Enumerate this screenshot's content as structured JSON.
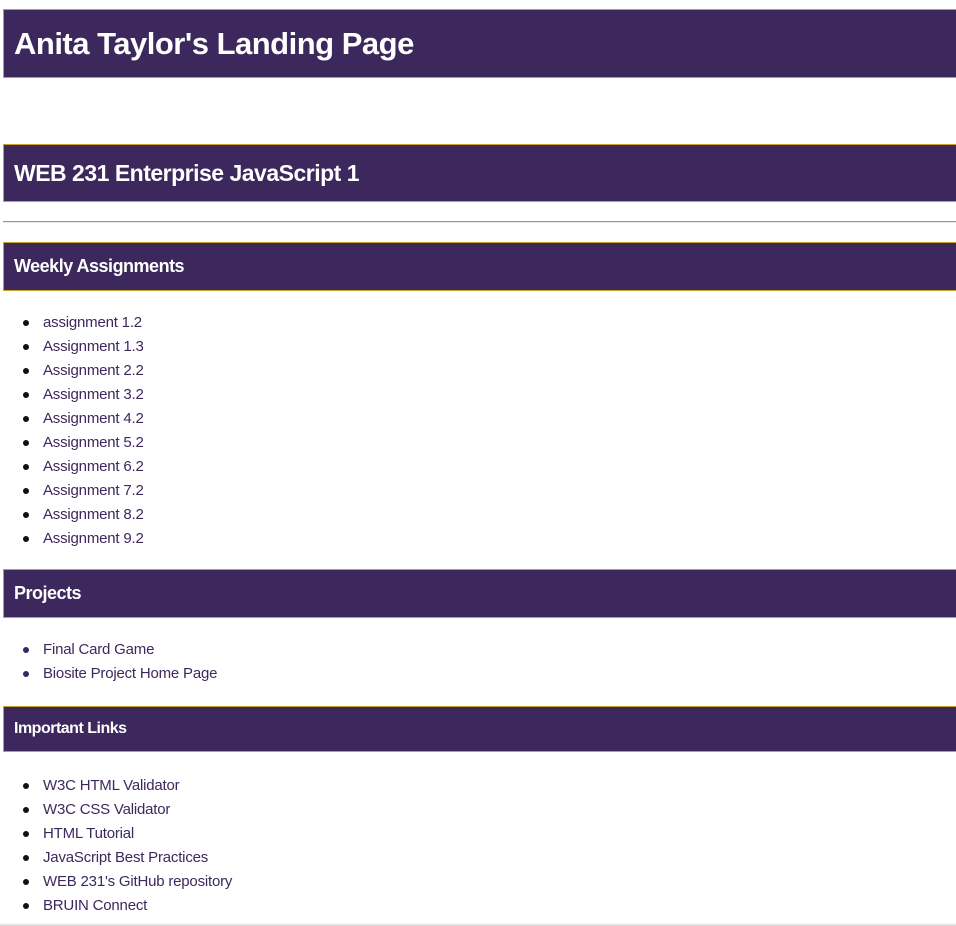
{
  "header": {
    "title": "Anita Taylor's Landing Page"
  },
  "course": {
    "title": "WEB 231 Enterprise JavaScript 1"
  },
  "weekly": {
    "heading": "Weekly Assignments",
    "items": [
      "assignment 1.2",
      "Assignment 1.3",
      "Assignment 2.2",
      "Assignment 3.2",
      "Assignment 4.2",
      "Assignment 5.2",
      "Assignment 6.2",
      "Assignment 7.2",
      "Assignment 8.2",
      "Assignment 9.2"
    ]
  },
  "projects": {
    "heading": "Projects",
    "items": [
      "Final Card Game",
      "Biosite Project Home Page"
    ]
  },
  "links": {
    "heading": "Important Links",
    "items": [
      "W3C HTML Validator",
      "W3C CSS Validator",
      "HTML Tutorial",
      "JavaScript Best Practices",
      "WEB 231's GitHub repository",
      "BRUIN Connect"
    ]
  },
  "colors": {
    "banner_bg": "#3d285d",
    "banner_border": "#c9a227",
    "link": "#3d285d"
  }
}
